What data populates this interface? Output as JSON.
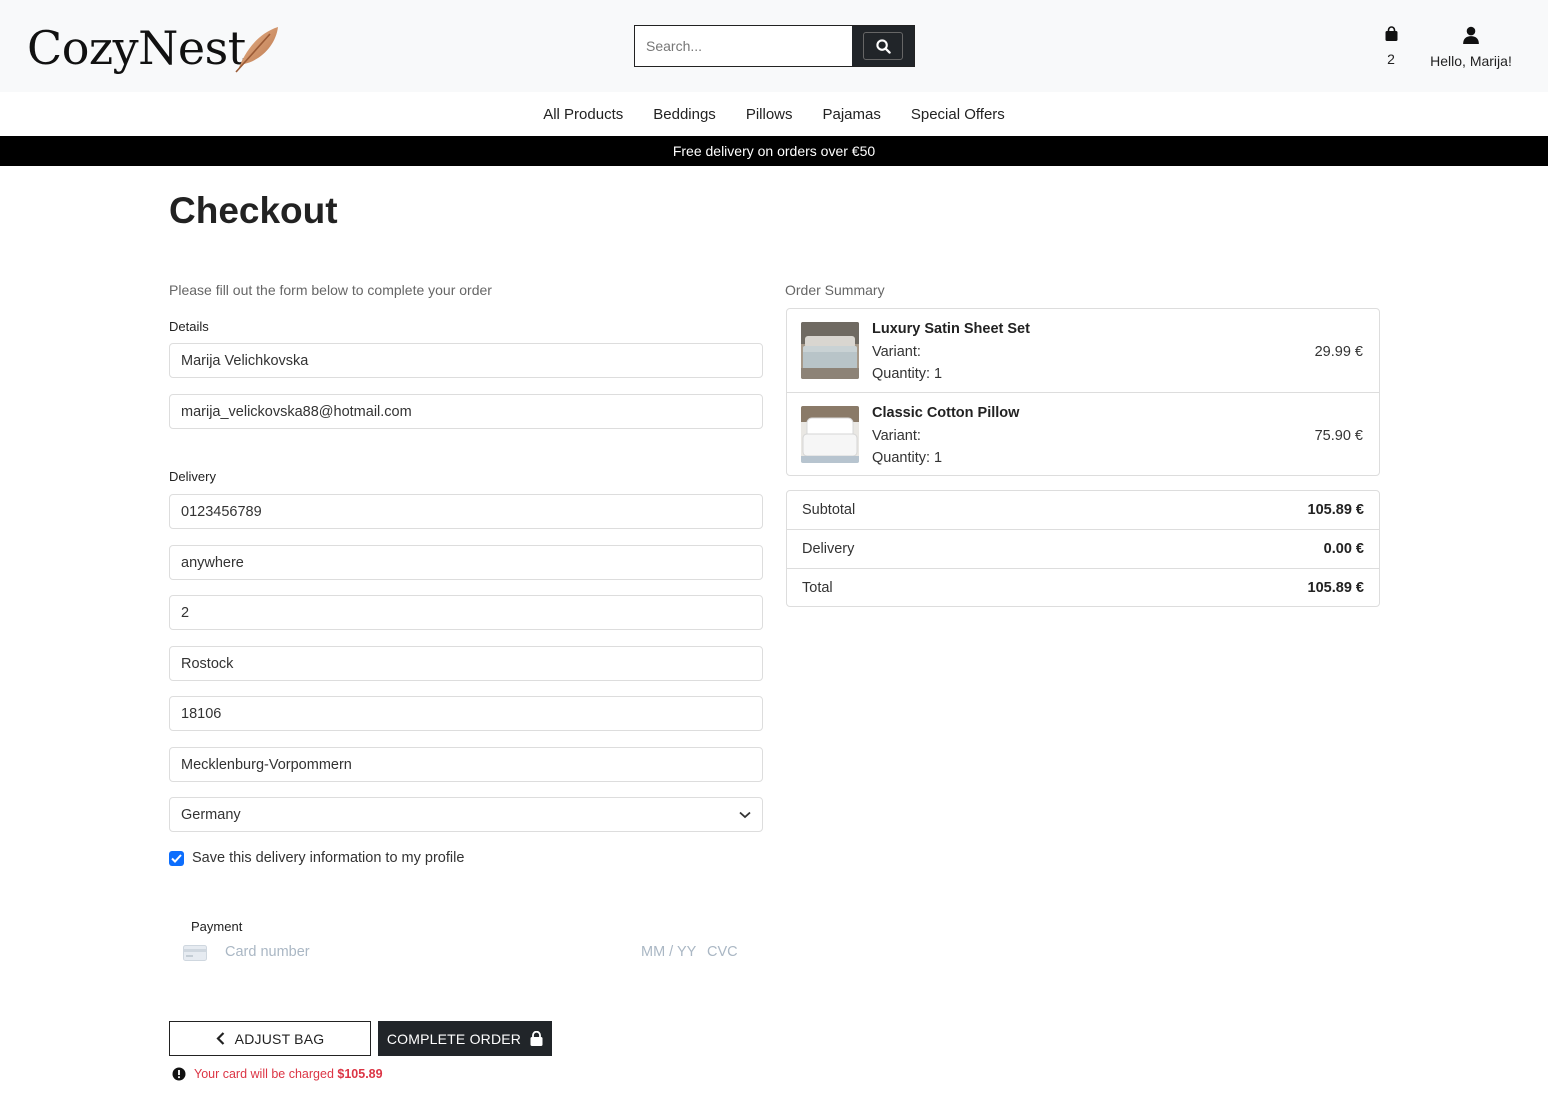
{
  "brand": {
    "name": "CozyNest"
  },
  "search": {
    "placeholder": "Search..."
  },
  "header": {
    "bag_count": "2",
    "user_greeting": "Hello, Marija!"
  },
  "nav": {
    "items": [
      "All Products",
      "Beddings",
      "Pillows",
      "Pajamas",
      "Special Offers"
    ]
  },
  "banner": {
    "text": "Free delivery on orders over €50"
  },
  "page": {
    "title": "Checkout"
  },
  "form": {
    "intro": "Please fill out the form below to complete your order",
    "details_label": "Details",
    "full_name": "Marija Velichkovska",
    "email": "marija_velickovska88@hotmail.com",
    "delivery_label": "Delivery",
    "phone": "0123456789",
    "street1": "anywhere",
    "street2": "2",
    "town": "Rostock",
    "postcode": "18106",
    "county": "Mecklenburg-Vorpommern",
    "country": "Germany",
    "save_info_label": "Save this delivery information to my profile",
    "save_info_checked": true,
    "payment_label": "Payment",
    "card_placeholder": "Card number",
    "card_expiry_placeholder": "MM / YY",
    "card_cvc_placeholder": "CVC"
  },
  "actions": {
    "adjust_label": "ADJUST BAG",
    "complete_label": "COMPLETE ORDER",
    "charge_text": "Your card will be charged",
    "charge_amount": "$105.89"
  },
  "summary": {
    "title": "Order Summary",
    "items": [
      {
        "name": "Luxury Satin Sheet Set",
        "variant": "Variant:",
        "quantity": "Quantity: 1",
        "price": "29.99 €"
      },
      {
        "name": "Classic Cotton Pillow",
        "variant": "Variant:",
        "quantity": "Quantity: 1",
        "price": "75.90 €"
      }
    ],
    "subtotal_label": "Subtotal",
    "subtotal": "105.89 €",
    "delivery_label": "Delivery",
    "delivery": "0.00 €",
    "total_label": "Total",
    "total": "105.89 €"
  },
  "colors": {
    "accent_dark": "#212529",
    "banner": "#000000",
    "checkbox": "#0d6efd",
    "error": "#dc3545",
    "logo_feather": "#c98a5e"
  }
}
